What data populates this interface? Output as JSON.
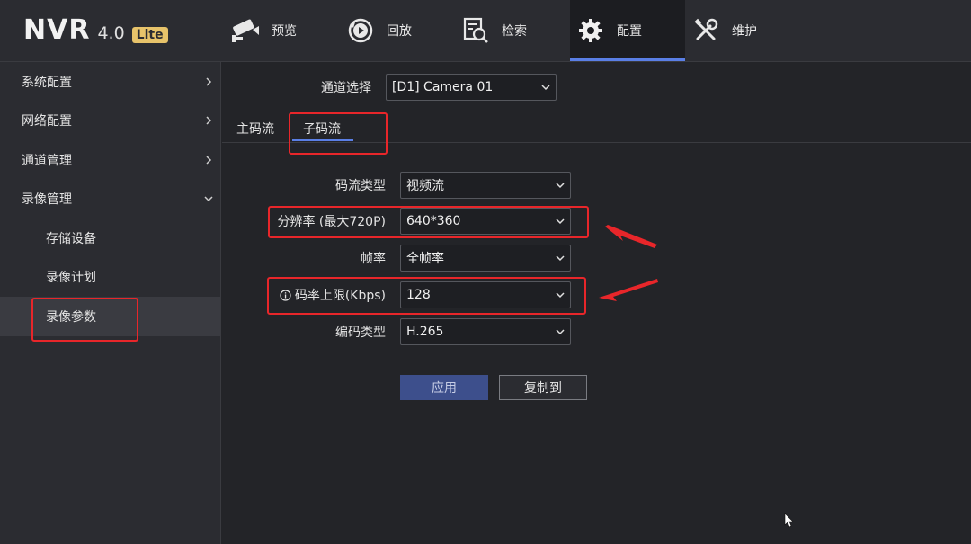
{
  "brand": {
    "name": "NVR",
    "version": "4.0",
    "edition": "Lite"
  },
  "nav": [
    {
      "label": "预览",
      "icon": "camera-icon",
      "active": false
    },
    {
      "label": "回放",
      "icon": "playback-icon",
      "active": false
    },
    {
      "label": "检索",
      "icon": "search-icon",
      "active": false
    },
    {
      "label": "配置",
      "icon": "gear-icon",
      "active": true
    },
    {
      "label": "维护",
      "icon": "wrench-icon",
      "active": false
    }
  ],
  "sidebar": {
    "items": [
      {
        "label": "系统配置",
        "chevron": "right"
      },
      {
        "label": "网络配置",
        "chevron": "right"
      },
      {
        "label": "通道管理",
        "chevron": "right"
      },
      {
        "label": "录像管理",
        "chevron": "down"
      }
    ],
    "sub_items": [
      {
        "label": "存储设备",
        "active": false
      },
      {
        "label": "录像计划",
        "active": false
      },
      {
        "label": "录像参数",
        "active": true
      }
    ]
  },
  "channel": {
    "label": "通道选择",
    "value": "[D1] Camera 01"
  },
  "tabs": [
    {
      "label": "主码流",
      "active": false
    },
    {
      "label": "子码流",
      "active": true
    }
  ],
  "form": {
    "stream_type": {
      "label": "码流类型",
      "value": "视频流"
    },
    "resolution": {
      "label": "分辨率 (最大720P)",
      "value": "640*360"
    },
    "frame_rate": {
      "label": "帧率",
      "value": "全帧率"
    },
    "bitrate_limit": {
      "label": "码率上限(Kbps)",
      "value": "128"
    },
    "encoding": {
      "label": "编码类型",
      "value": "H.265"
    }
  },
  "buttons": {
    "apply": "应用",
    "copy_to": "复制到"
  },
  "colors": {
    "accent": "#5a7fe6",
    "annotation": "#e8262a",
    "background": "#232428",
    "panel": "#2b2c31"
  }
}
